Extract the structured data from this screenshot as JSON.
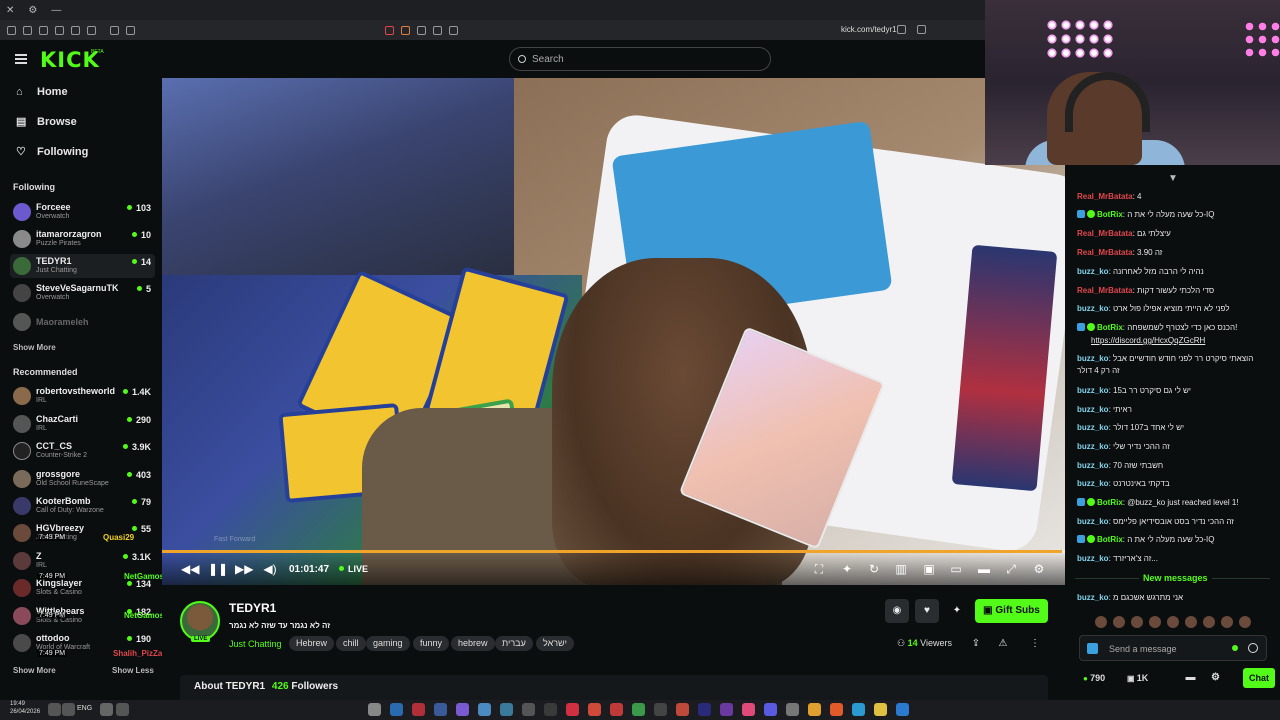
{
  "browser": {
    "url": "kick.com/tedyr1"
  },
  "header": {
    "logo": "KICK",
    "logo_badge": "BETA",
    "search_placeholder": "Search"
  },
  "sidebar": {
    "nav": [
      {
        "label": "Home",
        "icon": "home-icon"
      },
      {
        "label": "Browse",
        "icon": "browse-icon"
      },
      {
        "label": "Following",
        "icon": "heart-icon"
      }
    ],
    "following_title": "Following",
    "following": [
      {
        "name": "Forceee",
        "category": "Overwatch",
        "viewers": "103",
        "color": "#6a5acd"
      },
      {
        "name": "itamarorzagron",
        "category": "Puzzle Pirates",
        "viewers": "10",
        "color": "#8a8a8a"
      },
      {
        "name": "TEDYR1",
        "category": "Just Chatting",
        "viewers": "14",
        "color": "#3a6a3a",
        "active": true
      },
      {
        "name": "SteveVeSagarnuTK",
        "category": "Overwatch",
        "viewers": "5",
        "color": "#444"
      },
      {
        "name": "Maorameleh",
        "category": "",
        "viewers": "",
        "color": "#555",
        "offline": true
      }
    ],
    "show_more": "Show More",
    "recommended_title": "Recommended",
    "recommended": [
      {
        "name": "robertovstheworld",
        "category": "IRL",
        "viewers": "1.4K",
        "color": "#8a6a4a"
      },
      {
        "name": "ChazCarti",
        "category": "IRL",
        "viewers": "290",
        "color": "#555"
      },
      {
        "name": "CCT_CS",
        "category": "Counter-Strike 2",
        "viewers": "3.9K",
        "color": "#222"
      },
      {
        "name": "grossgore",
        "category": "Old School RuneScape",
        "viewers": "403",
        "color": "#7a6a5a"
      },
      {
        "name": "KooterBomb",
        "category": "Call of Duty: Warzone",
        "viewers": "79",
        "color": "#3a3a6a"
      },
      {
        "name": "HGVbreezy",
        "category": "Just Chatting",
        "viewers": "55",
        "color": "#6a4a3a"
      },
      {
        "name": "Z",
        "category": "IRL",
        "viewers": "3.1K",
        "color": "#5a3a3a"
      },
      {
        "name": "Kingslayer",
        "category": "Slots & Casino",
        "viewers": "134",
        "color": "#6a2a2a"
      },
      {
        "name": "Wittlebears",
        "category": "Slots & Casino",
        "viewers": "182",
        "color": "#8a4a5a"
      },
      {
        "name": "ottodoo",
        "category": "World of Warcraft",
        "viewers": "190",
        "color": "#4a4a4a"
      }
    ],
    "show_more_bottom": "Show More",
    "show_less": "Show Less"
  },
  "overlay_chat": [
    {
      "time": "7:49 PM",
      "user": "Quasi29",
      "color": "#f0d020"
    },
    {
      "time": "7:49 PM",
      "user": "NetGamos",
      "color": "#53fc18"
    },
    {
      "time": "7:49 PM",
      "user": "NetGamos",
      "color": "#53fc18"
    },
    {
      "time": "7:49 PM",
      "user": "Shalih_PizZa",
      "color": "#e0464c"
    }
  ],
  "player": {
    "time": "01:01:47",
    "live_label": "LIVE",
    "tooltip": "Fast Forward",
    "progress": 0.997
  },
  "channel": {
    "name": "TEDYR1",
    "title": "זה לא נגמר עד שזה לא נגמר",
    "category": "Just Chatting",
    "tags": [
      "Hebrew",
      "chill",
      "gaming",
      "funny",
      "hebrew",
      "עברית",
      "ישראל"
    ],
    "live_badge": "LIVE",
    "gift_label": "Gift Subs",
    "viewers": "14",
    "viewers_label": "Viewers",
    "about_label": "About TEDYR1",
    "followers": "426",
    "followers_label": "Followers"
  },
  "chat": {
    "messages": [
      {
        "user": "Real_MrBatata",
        "color": "red",
        "text": "4"
      },
      {
        "user": "BotRix",
        "color": "green",
        "text": "כל שעה מעלה לי את ה-IQ",
        "bot": true
      },
      {
        "user": "Real_MrBatata",
        "color": "red",
        "text": "עיצלתי גם"
      },
      {
        "user": "Real_MrBatata",
        "color": "red",
        "text": "3.90 זה"
      },
      {
        "user": "buzz_ko",
        "color": "cyan",
        "text": "נהיה לי הרבה מזל לאחרונה"
      },
      {
        "user": "Real_MrBatata",
        "color": "red",
        "text": "סדי הלכתי לעשור דקות"
      },
      {
        "user": "buzz_ko",
        "color": "cyan",
        "text": "לפני לא הייתי מוציא אפילו פול ארט"
      },
      {
        "user": "BotRix",
        "color": "green",
        "text": "הכנס כאן כדי לצטרף לשמשפחה!",
        "bot": true
      },
      {
        "user": "",
        "color": "cyan",
        "text": "https://discord.gg/HcxQqZGcRH",
        "link": true
      },
      {
        "user": "buzz_ko",
        "color": "cyan",
        "text": "הוצאתי סיקרט רר לפני חודש חודשיים אבל"
      },
      {
        "user": "",
        "color": "cyan",
        "text": "זה רק 4 דולר"
      },
      {
        "user": "buzz_ko",
        "color": "cyan",
        "text": "יש לי גם סיקרט רר ב15"
      },
      {
        "user": "buzz_ko",
        "color": "cyan",
        "text": "ראיתי"
      },
      {
        "user": "buzz_ko",
        "color": "cyan",
        "text": "יש לי אחד ב107 דולר"
      },
      {
        "user": "buzz_ko",
        "color": "cyan",
        "text": "זה ההכי נדיר שלי"
      },
      {
        "user": "buzz_ko",
        "color": "cyan",
        "text": "חשבתי שזה 70"
      },
      {
        "user": "buzz_ko",
        "color": "cyan",
        "text": "בדקתי באינטרנט"
      },
      {
        "user": "BotRix",
        "color": "green",
        "text": "@buzz_ko just reached level 1!",
        "bot": true
      },
      {
        "user": "buzz_ko",
        "color": "cyan",
        "text": "זה ההכי נדיר בסט אובסידיאן פליימס"
      },
      {
        "user": "BotRix",
        "color": "green",
        "text": "כל שעה מעלה לי את ה-IQ",
        "bot": true
      },
      {
        "user": "buzz_ko",
        "color": "cyan",
        "text": "זה צ'אריזרד..."
      }
    ],
    "new_messages_label": "New messages",
    "last_message": {
      "user": "buzz_ko",
      "text": "אני מתרגש אשכגם מ"
    },
    "input_placeholder": "Send a message",
    "points": "790",
    "kick_points": "1K",
    "chat_button": "Chat"
  },
  "taskbar": {
    "time": "19:49",
    "date": "26/04/2026",
    "lang": "ENG"
  }
}
